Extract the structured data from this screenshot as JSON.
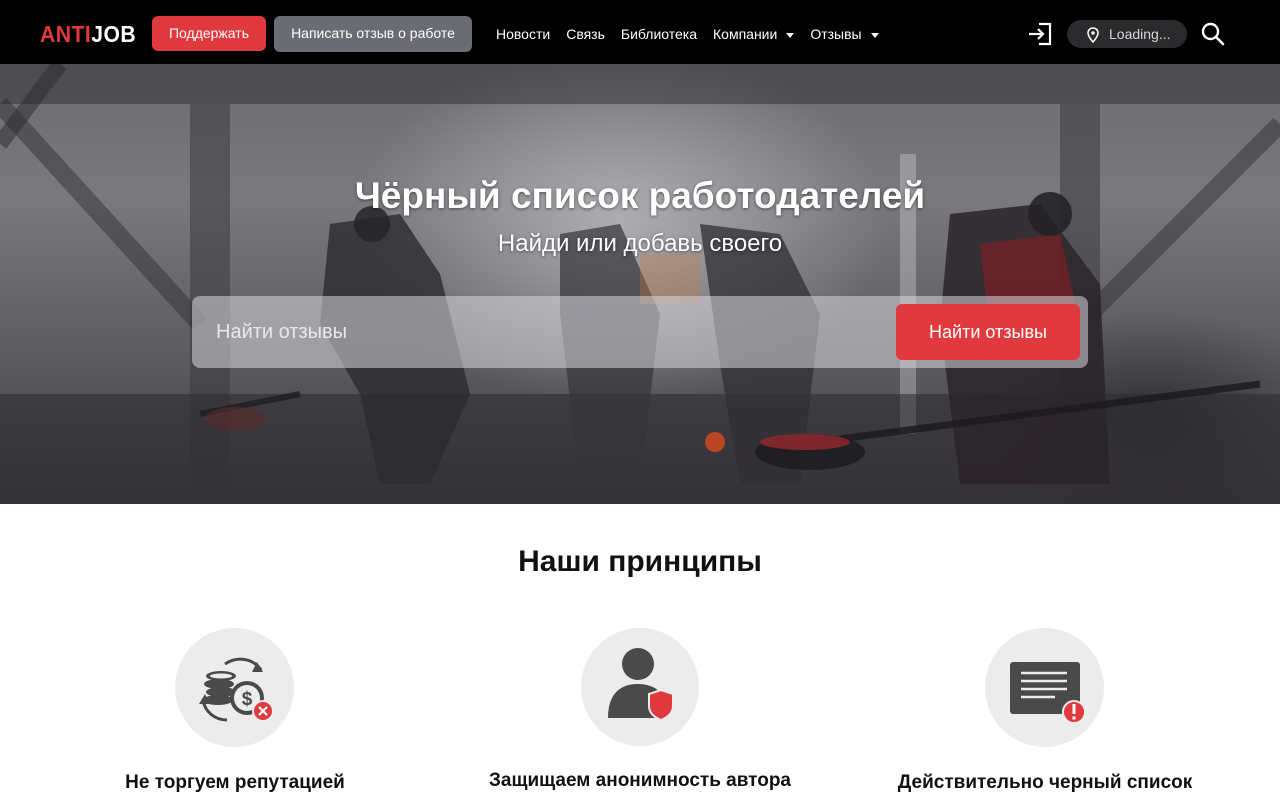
{
  "navbar": {
    "logo_anti": "ANTI",
    "logo_job": "JOB",
    "support_label": "Поддержать",
    "write_review_label": "Написать отзыв о работе",
    "links": [
      {
        "label": "Новости"
      },
      {
        "label": "Связь"
      },
      {
        "label": "Библиотека"
      },
      {
        "label": "Компании",
        "dropdown": true
      },
      {
        "label": "Отзывы",
        "dropdown": true
      }
    ],
    "location_text": "Loading...",
    "icons": [
      "login-icon",
      "location-pin-icon",
      "search-icon"
    ]
  },
  "hero": {
    "title": "Чёрный список работодателей",
    "subtitle": "Найди или добавь своего",
    "search_placeholder": "Найти отзывы",
    "search_button": "Найти отзывы"
  },
  "principles": {
    "title": "Наши принципы",
    "items": [
      {
        "label": "Не торгуем репутацией",
        "icon": "no-money-exchange-icon"
      },
      {
        "label": "Защищаем анонимность автора",
        "icon": "anonymous-user-shield-icon"
      },
      {
        "label": "Действительно черный список",
        "icon": "document-alert-icon"
      }
    ]
  },
  "colors": {
    "accent": "#e03a3e",
    "navbar_bg": "#000000",
    "secondary_button": "#6b6b73",
    "icon_circle": "#ececec",
    "icon_gray": "#4a4a4a"
  }
}
